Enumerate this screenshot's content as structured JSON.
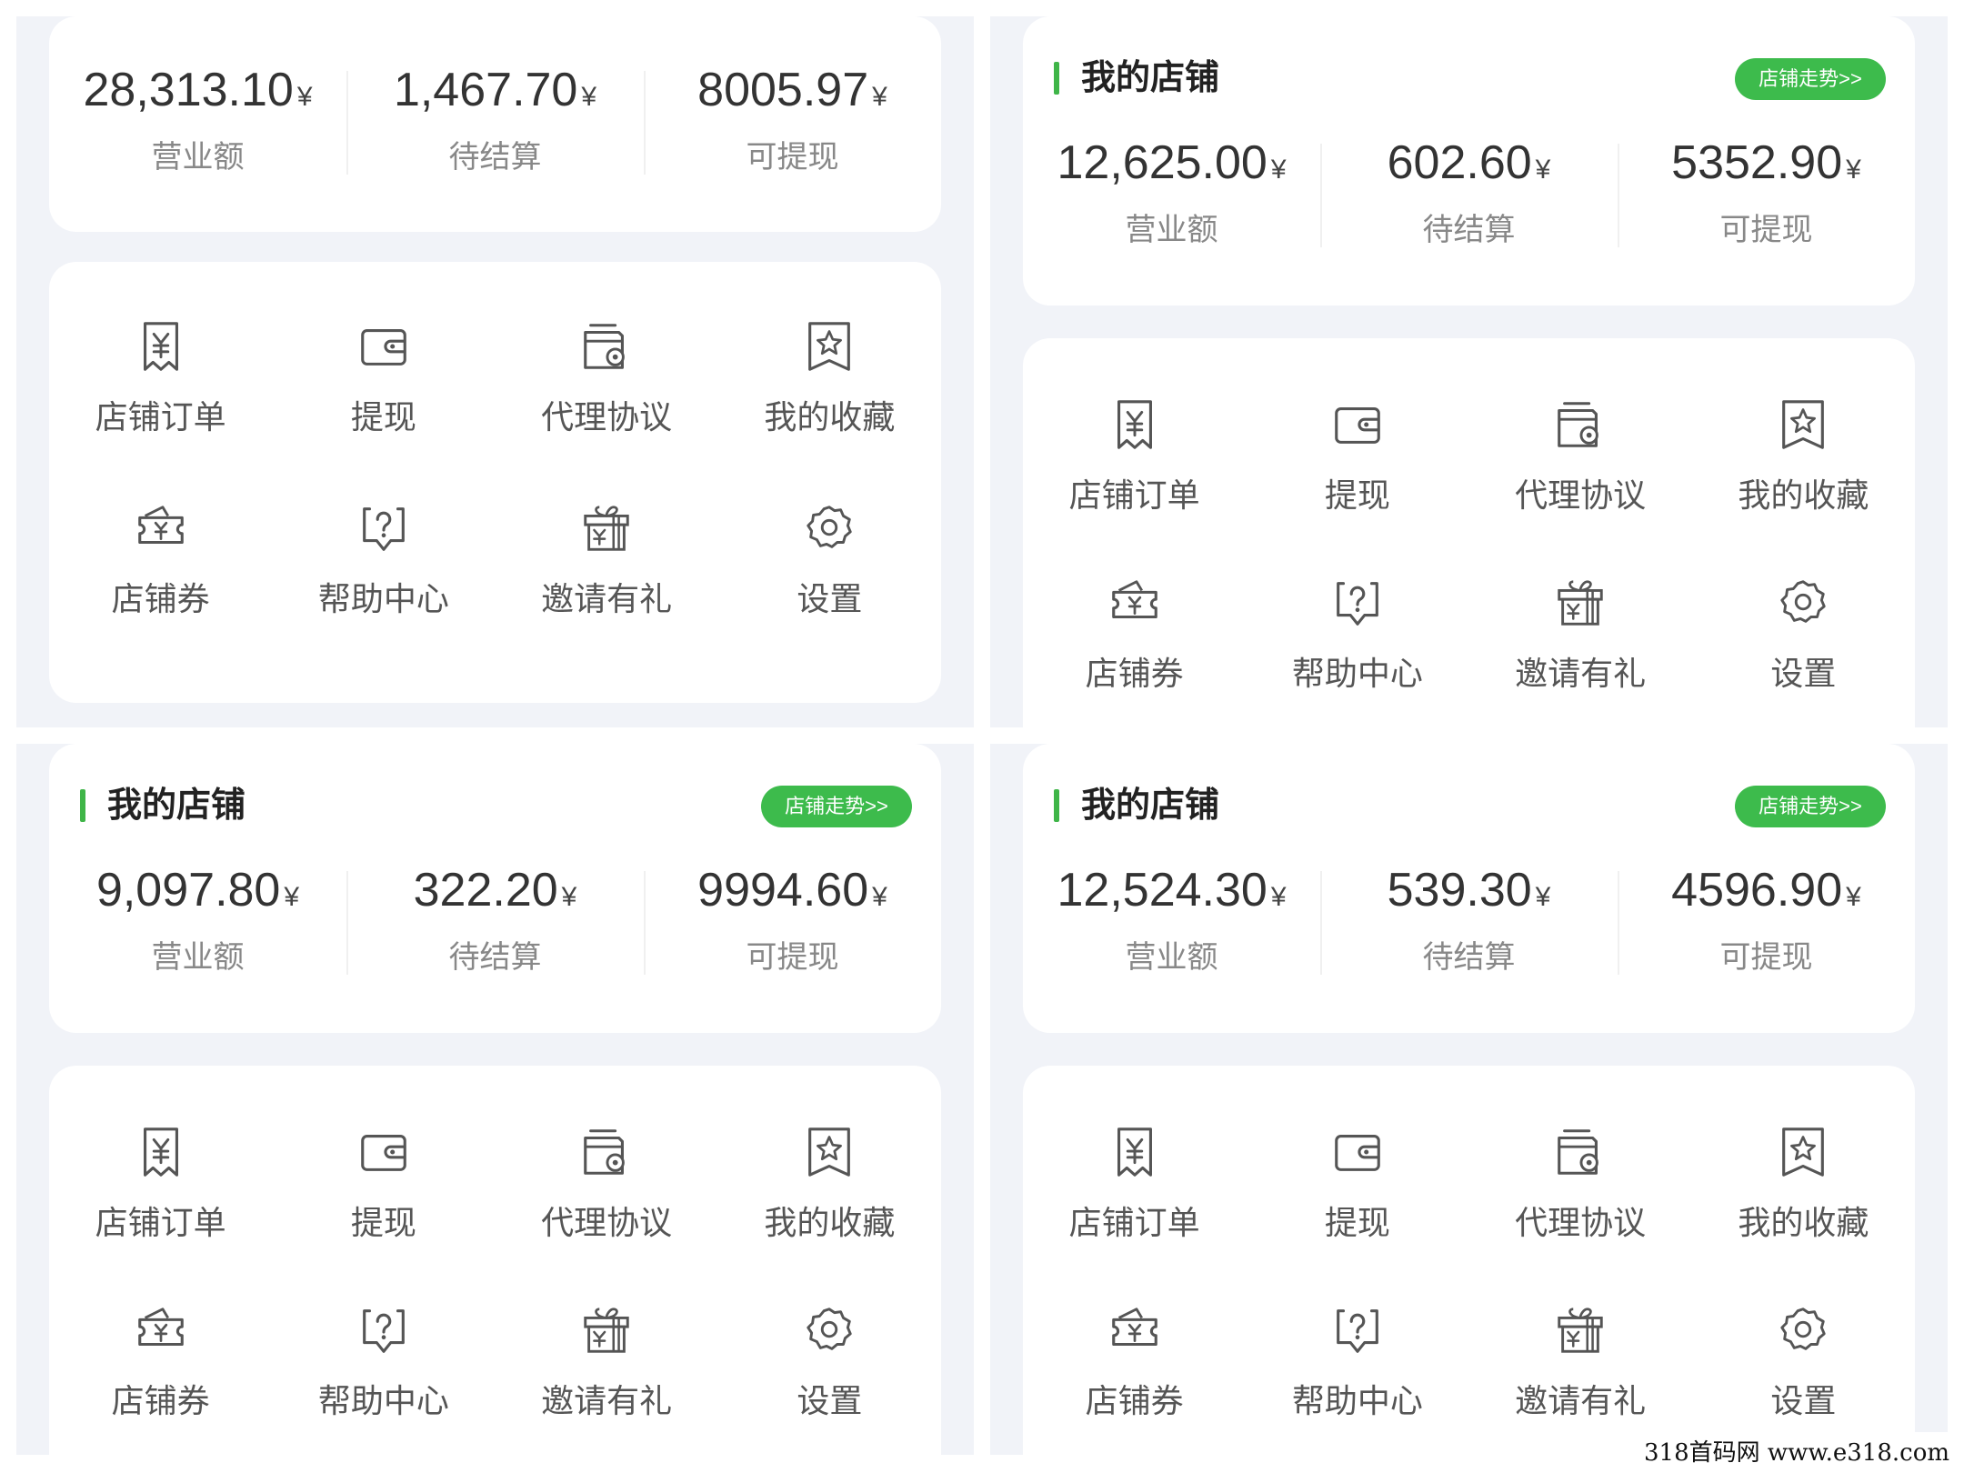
{
  "panels": [
    {
      "title": "",
      "trend_button": "",
      "stats": [
        {
          "value": "28,313.10",
          "unit": "¥",
          "label": "营业额"
        },
        {
          "value": "1,467.70",
          "unit": "¥",
          "label": "待结算"
        },
        {
          "value": "8005.97",
          "unit": "¥",
          "label": "可提现"
        }
      ]
    },
    {
      "title": "我的店铺",
      "trend_button": "店铺走势>>",
      "stats": [
        {
          "value": "12,625.00",
          "unit": "¥",
          "label": "营业额"
        },
        {
          "value": "602.60",
          "unit": "¥",
          "label": "待结算"
        },
        {
          "value": "5352.90",
          "unit": "¥",
          "label": "可提现"
        }
      ]
    },
    {
      "title": "我的店铺",
      "trend_button": "店铺走势>>",
      "stats": [
        {
          "value": "9,097.80",
          "unit": "¥",
          "label": "营业额"
        },
        {
          "value": "322.20",
          "unit": "¥",
          "label": "待结算"
        },
        {
          "value": "9994.60",
          "unit": "¥",
          "label": "可提现"
        }
      ]
    },
    {
      "title": "我的店铺",
      "trend_button": "店铺走势>>",
      "stats": [
        {
          "value": "12,524.30",
          "unit": "¥",
          "label": "营业额"
        },
        {
          "value": "539.30",
          "unit": "¥",
          "label": "待结算"
        },
        {
          "value": "4596.90",
          "unit": "¥",
          "label": "可提现"
        }
      ]
    }
  ],
  "menu": [
    {
      "label": "店铺订单",
      "icon": "order-receipt-icon"
    },
    {
      "label": "提现",
      "icon": "wallet-icon"
    },
    {
      "label": "代理协议",
      "icon": "agreement-icon"
    },
    {
      "label": "我的收藏",
      "icon": "favorite-star-icon"
    },
    {
      "label": "店铺券",
      "icon": "coupon-icon"
    },
    {
      "label": "帮助中心",
      "icon": "help-icon"
    },
    {
      "label": "邀请有礼",
      "icon": "gift-icon"
    },
    {
      "label": "设置",
      "icon": "settings-gear-icon"
    }
  ],
  "watermark": "318首码网  www.e318.com",
  "colors": {
    "accent": "#3dbb4c",
    "panel_bg": "#f1f3f8",
    "card_bg": "#ffffff",
    "label_gray": "#888888"
  }
}
